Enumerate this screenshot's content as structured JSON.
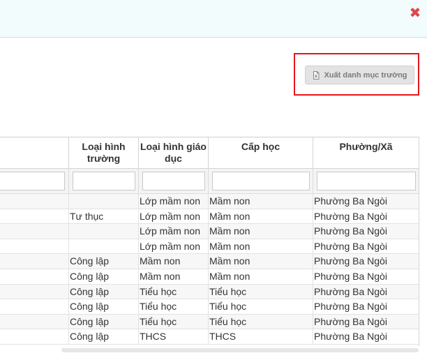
{
  "dialog": {
    "close_symbol": "✖"
  },
  "toolbar": {
    "export_label": "Xuất danh mục trường",
    "export_icon": "excel-file-icon"
  },
  "table": {
    "headers": [
      "",
      "Loại hình trường",
      "Loại hình giáo dục",
      "Cấp học",
      "Phường/Xã"
    ],
    "rows": [
      [
        "",
        "",
        "Lớp mầm non",
        "Mầm non",
        "Phường Ba Ngòi"
      ],
      [
        "",
        "Tư thục",
        "Lớp mầm non",
        "Mầm non",
        "Phường Ba Ngòi"
      ],
      [
        "",
        "",
        "Lớp mầm non",
        "Mầm non",
        "Phường Ba Ngòi"
      ],
      [
        "",
        "",
        "Lớp mầm non",
        "Mầm non",
        "Phường Ba Ngòi"
      ],
      [
        "",
        "Công lập",
        "Mầm non",
        "Mầm non",
        "Phường Ba Ngòi"
      ],
      [
        "",
        "Công lập",
        "Mầm non",
        "Mầm non",
        "Phường Ba Ngòi"
      ],
      [
        "",
        "Công lập",
        "Tiểu học",
        "Tiểu học",
        "Phường Ba Ngòi"
      ],
      [
        "",
        "Công lập",
        "Tiểu học",
        "Tiểu học",
        "Phường Ba Ngòi"
      ],
      [
        "",
        "Công lập",
        "Tiểu học",
        "Tiểu học",
        "Phường Ba Ngòi"
      ],
      [
        "",
        "Công lập",
        "THCS",
        "THCS",
        "Phường Ba Ngòi"
      ]
    ]
  },
  "colors": {
    "accent_red": "#e8131b",
    "close_red": "#e0454c",
    "header_bg": "#f2fcfd"
  }
}
